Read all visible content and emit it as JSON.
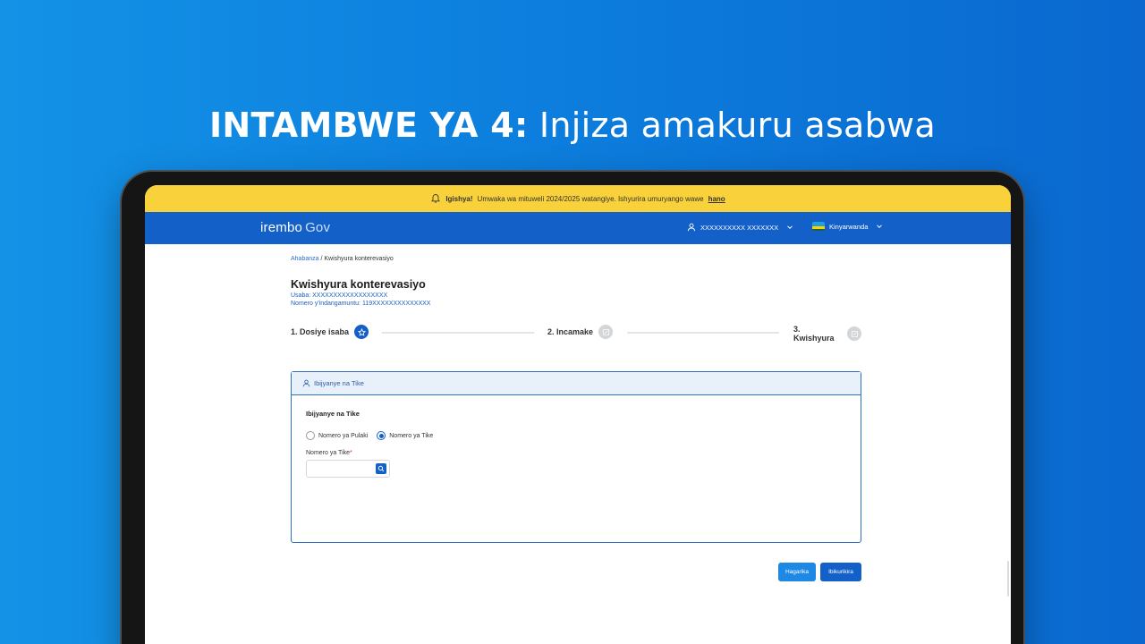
{
  "headline": {
    "strong": "INTAMBWE YA 4:",
    "light": "Injiza amakuru asabwa"
  },
  "banner": {
    "bold": "Igishya!",
    "text": "Umwaka wa mituweli 2024/2025 watangiye. Ishyurira umuryango wawe",
    "link": "hano"
  },
  "topbar": {
    "logo": "irembo",
    "logo_suffix": "Gov",
    "user_name": "XXXXXXXXXX XXXXXXX",
    "language": "Kinyarwanda"
  },
  "breadcrumb": {
    "home": "Ahabanza",
    "separator": " / ",
    "current": "Kwishyura konterevasiyo"
  },
  "page": {
    "title": "Kwishyura konterevasiyo",
    "applicant_label": "Usaba:",
    "applicant_value": "XXXXXXXXXXXXXXXXXX",
    "id_label": "Nomero y'indangamuntu:",
    "id_value": "119XXXXXXXXXXXXXX"
  },
  "steps": [
    {
      "label": "1. Dosiye isaba",
      "state": "active"
    },
    {
      "label": "2. Incamake",
      "state": "inactive"
    },
    {
      "label": "3. Kwishyura",
      "state": "inactive"
    }
  ],
  "card": {
    "header": "Ibijyanye na Tike",
    "section_title": "Ibijyanye na Tike",
    "radio_options": [
      "Nomero ya Pulaki",
      "Nomero ya Tike"
    ],
    "selected_radio": "Nomero ya Tike",
    "field_label": "Nomero ya Tike",
    "required_mark": "*",
    "field_value": ""
  },
  "actions": {
    "cancel": "Hagarika",
    "next": "Ibikurikira"
  },
  "colors": {
    "brand_blue": "#1460c9",
    "banner_yellow": "#f9d13a",
    "background_blue": "#0d7fde"
  }
}
